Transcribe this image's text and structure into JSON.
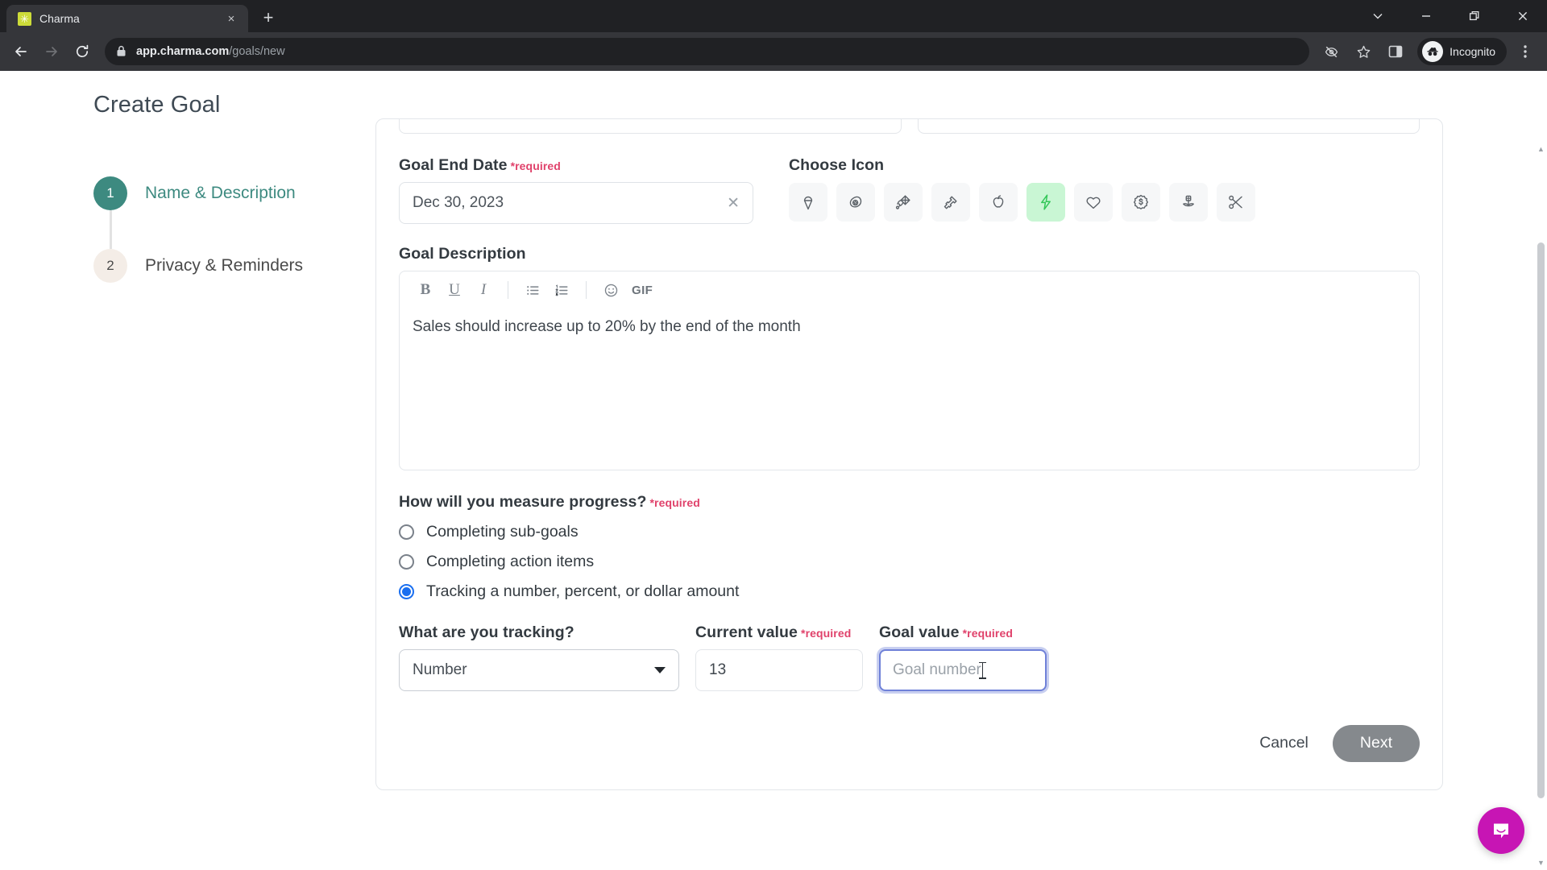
{
  "browser": {
    "tab": {
      "title": "Charma",
      "favicon": "charma-favicon",
      "close": "×"
    },
    "new_tab": "+",
    "window_controls": {
      "minimize": "–",
      "maximize": "❐",
      "close": "✕",
      "tab_search": "⌄"
    },
    "nav": {
      "back": "←",
      "forward": "→",
      "reload": "↻"
    },
    "omnibox": {
      "lock_icon": "lock-icon",
      "url_host": "app.charma.com",
      "url_path": "/goals/new"
    },
    "toolbar_icons": [
      "third-party-cookie-icon",
      "bookmark-star-icon",
      "side-panel-icon",
      "more-menu-icon"
    ],
    "profile": {
      "label": "Incognito"
    }
  },
  "page": {
    "title": "Create Goal"
  },
  "steps": [
    {
      "number": "1",
      "label": "Name & Description",
      "state": "active"
    },
    {
      "number": "2",
      "label": "Privacy & Reminders",
      "state": "idle"
    }
  ],
  "form": {
    "required_marker": "*required",
    "goal_end_date": {
      "label": "Goal End Date",
      "value": "Dec 30, 2023",
      "clear_icon": "✕"
    },
    "choose_icon": {
      "label": "Choose Icon",
      "selected_index": 5,
      "icons": [
        "ice-cream-icon",
        "avocado-icon",
        "kite-icon",
        "hammer-icon",
        "apple-icon",
        "lightning-bolt-icon",
        "heart-icon",
        "dollar-badge-icon",
        "flower-icon",
        "scissors-icon"
      ]
    },
    "goal_description": {
      "label": "Goal Description",
      "text": "Sales should increase up to 20% by the end of the month",
      "toolbar": {
        "bold": "B",
        "underline": "U",
        "italic": "I",
        "bullet_list": "bullet-list-icon",
        "numbered_list": "numbered-list-icon",
        "emoji": "☺",
        "gif": "GIF"
      }
    },
    "measure_progress": {
      "label": "How will you measure progress?",
      "options": [
        {
          "label": "Completing sub-goals",
          "checked": false
        },
        {
          "label": "Completing action items",
          "checked": false
        },
        {
          "label": "Tracking a number, percent, or dollar amount",
          "checked": true
        }
      ]
    },
    "tracking": {
      "type": {
        "label": "What are you tracking?",
        "value": "Number"
      },
      "current_value": {
        "label": "Current value",
        "value": "13"
      },
      "goal_value": {
        "label": "Goal value",
        "placeholder": "Goal number",
        "value": "",
        "focused": true
      }
    }
  },
  "footer": {
    "cancel_label": "Cancel",
    "next_label": "Next"
  },
  "widgets": {
    "intercom": "chat-bubble-icon"
  },
  "colors": {
    "accent_teal": "#3d8a80",
    "required_pink": "#e0426b",
    "selected_icon_bg": "#c9f6d4",
    "selected_icon_fg": "#34c759",
    "radio_blue": "#1a6ff0",
    "focus_ring": "#c8cff0",
    "next_disabled": "#85898d",
    "intercom_magenta": "#c715b4"
  }
}
